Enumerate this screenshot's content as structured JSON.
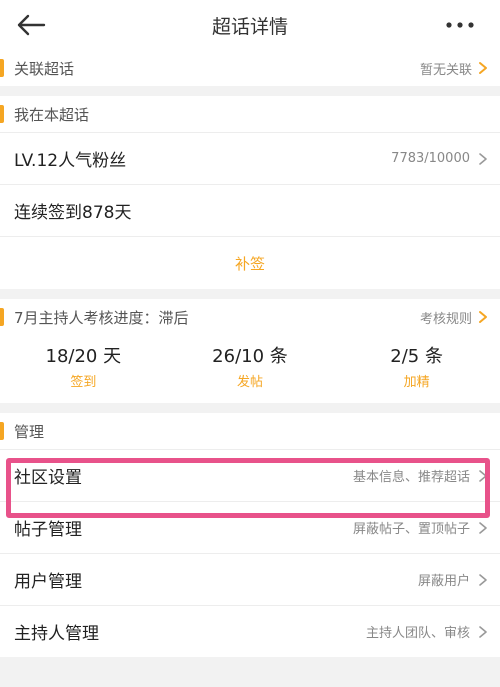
{
  "header": {
    "title": "超话详情"
  },
  "related": {
    "title": "关联超话",
    "status": "暂无关联"
  },
  "my_in_topic": {
    "title": "我在本超话",
    "level_label": "LV.12人气粉丝",
    "level_progress": "7783/10000",
    "checkin_label": "连续签到878天",
    "makeup_label": "补签"
  },
  "assessment": {
    "title": "7月主持人考核进度：滞后",
    "rules_label": "考核规则",
    "stats": [
      {
        "value": "18/20 天",
        "label": "签到"
      },
      {
        "value": "26/10 条",
        "label": "发帖"
      },
      {
        "value": "2/5 条",
        "label": "加精"
      }
    ]
  },
  "management": {
    "title": "管理",
    "items": [
      {
        "label": "社区设置",
        "detail": "基本信息、推荐超话"
      },
      {
        "label": "帖子管理",
        "detail": "屏蔽帖子、置顶帖子"
      },
      {
        "label": "用户管理",
        "detail": "屏蔽用户"
      },
      {
        "label": "主持人管理",
        "detail": "主持人团队、审核"
      }
    ]
  },
  "colors": {
    "accent": "#f5a623",
    "highlight": "#e8528a",
    "background": "#f2f2f2"
  }
}
